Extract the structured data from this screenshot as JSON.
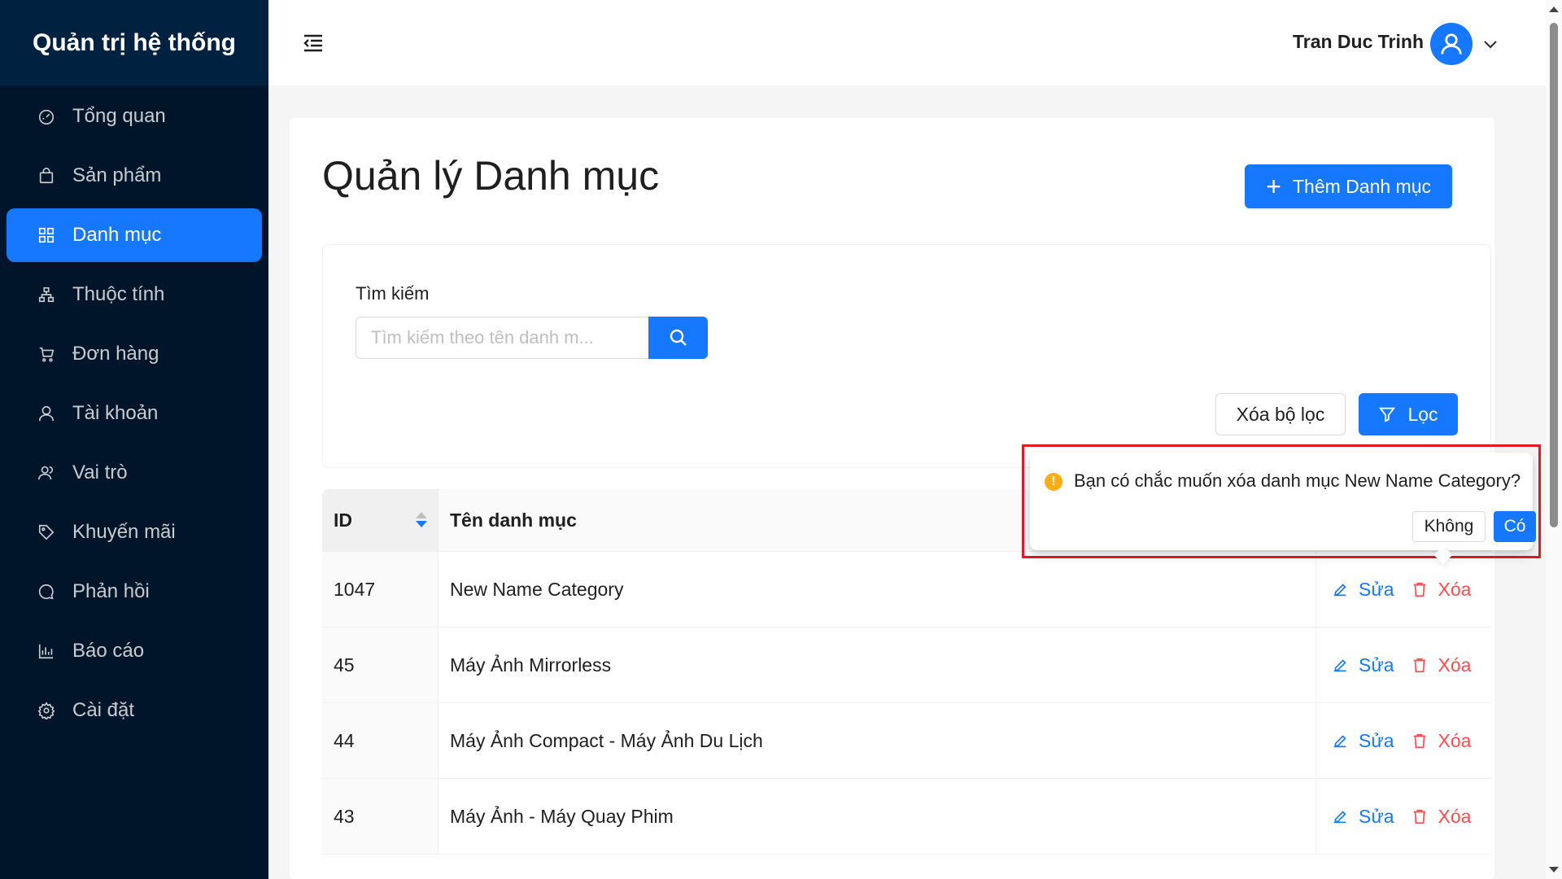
{
  "sidebar": {
    "brand": "Quản trị hệ thống",
    "items": [
      {
        "label": "Tổng quan",
        "icon": "dashboard-icon"
      },
      {
        "label": "Sản phẩm",
        "icon": "shopping-bag-icon"
      },
      {
        "label": "Danh mục",
        "icon": "grid-icon",
        "active": true
      },
      {
        "label": "Thuộc tính",
        "icon": "cluster-icon"
      },
      {
        "label": "Đơn hàng",
        "icon": "cart-icon"
      },
      {
        "label": "Tài khoản",
        "icon": "user-icon"
      },
      {
        "label": "Vai trò",
        "icon": "team-icon"
      },
      {
        "label": "Khuyến mãi",
        "icon": "tag-icon"
      },
      {
        "label": "Phản hồi",
        "icon": "message-icon"
      },
      {
        "label": "Báo cáo",
        "icon": "bar-chart-icon"
      },
      {
        "label": "Cài đặt",
        "icon": "settings-icon"
      }
    ]
  },
  "header": {
    "user_name": "Tran Duc Trinh"
  },
  "main": {
    "title": "Quản lý Danh mục",
    "add_button": "Thêm Danh mục",
    "filter": {
      "label": "Tìm kiếm",
      "placeholder": "Tìm kiếm theo tên danh m...",
      "clear_button": "Xóa bộ lọc",
      "filter_button": "Lọc"
    },
    "table": {
      "columns": [
        "ID",
        "Tên danh mục"
      ],
      "rows": [
        {
          "id": "1047",
          "name": "New Name Category"
        },
        {
          "id": "45",
          "name": "Máy Ảnh Mirrorless"
        },
        {
          "id": "44",
          "name": "Máy Ảnh Compact - Máy Ảnh Du Lịch"
        },
        {
          "id": "43",
          "name": "Máy Ảnh - Máy Quay Phim"
        }
      ],
      "edit_label": "Sửa",
      "delete_label": "Xóa"
    }
  },
  "popconfirm": {
    "message": "Bạn có chắc muốn xóa danh mục New Name Category?",
    "no_label": "Không",
    "yes_label": "Có"
  },
  "colors": {
    "primary": "#1677ff",
    "sidebar_bg": "#001529",
    "danger": "#ff4d4f",
    "warning": "#faad14",
    "highlight_border": "#e01b24"
  }
}
